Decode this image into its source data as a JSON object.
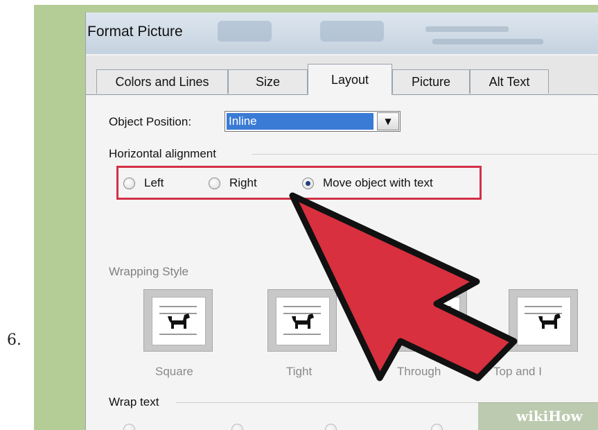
{
  "step": {
    "number": "6."
  },
  "dialog": {
    "title": "Format Picture",
    "tabs": [
      {
        "label": "Colors and Lines"
      },
      {
        "label": "Size"
      },
      {
        "label": "Layout",
        "active": true
      },
      {
        "label": "Picture"
      },
      {
        "label": "Alt Text"
      }
    ],
    "object_position": {
      "label": "Object Position:",
      "value": "Inline"
    },
    "horizontal_alignment": {
      "label": "Horizontal alignment",
      "options": [
        {
          "label": "Left",
          "checked": false
        },
        {
          "label": "Right",
          "checked": false
        },
        {
          "label": "Move object with text",
          "checked": true
        }
      ]
    },
    "wrapping_style": {
      "label": "Wrapping Style",
      "items": [
        {
          "label": "Square"
        },
        {
          "label": "Tight"
        },
        {
          "label": "Through"
        },
        {
          "label": "Top and I"
        }
      ]
    },
    "wrap_text": {
      "label": "Wrap text"
    }
  },
  "watermark": {
    "text": "wikiHow"
  },
  "colors": {
    "highlight": "#d33045",
    "arrow": "#d8303e",
    "background": "#b4cc95",
    "selection": "#3a7bd5"
  }
}
